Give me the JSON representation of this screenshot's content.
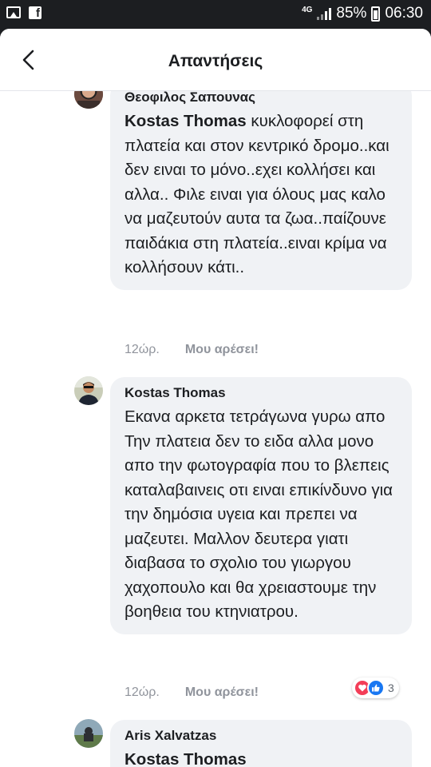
{
  "status_bar": {
    "network": "4G",
    "battery": "85%",
    "time": "06:30",
    "icons": [
      "gallery-icon",
      "facebook-icon",
      "signal-icon",
      "battery-icon"
    ]
  },
  "header": {
    "title": "Απαντήσεις",
    "back_icon": "back-arrow-icon"
  },
  "comments": [
    {
      "author": "Θεοφιλος Σαπουνας",
      "mention": "Kostas Thomas",
      "text": "κυκλοφορεί στη πλατεία και στον κεντρικό δρομο..και δεν ειναι το μόνο..εχει κολλήσει και αλλα.. Φιλε ειναι για όλους μας καλο να μαζευτούν αυτα τα ζωα..παίζουνε παιδάκια στη πλατεία..ειναι κρίμα να κολλήσουν κάτι..",
      "time": "12ώρ.",
      "like_label": "Μου αρέσει!"
    },
    {
      "author": "Kostas Thomas",
      "text": "Εκανα αρκετα τετράγωνα γυρω απο Την πλατεια δεν το ειδα αλλα μονο απο την φωτογραφία που το βλεπεις καταλαβαινεις οτι ειναι επικίνδυνο για την δημόσια υγεια και πρεπει να μαζευτει. Μαλλον δευτερα γιατι διαβασα το σχολιο του γιωργου χαχοπουλο και θα χρειαστουμε την βοηθεια του κτηνιατρου.",
      "time": "12ώρ.",
      "like_label": "Μου αρέσει!",
      "reactions": {
        "icons": [
          "love-reaction-icon",
          "like-reaction-icon"
        ],
        "count": "3"
      }
    },
    {
      "author": "Aris Xalvatzas",
      "mention": "Kostas Thomas",
      "text": "..."
    }
  ],
  "colors": {
    "bubble": "#f0f2f5",
    "love": "#f33e58",
    "like": "#1877f2",
    "meta_text": "#90949c"
  }
}
